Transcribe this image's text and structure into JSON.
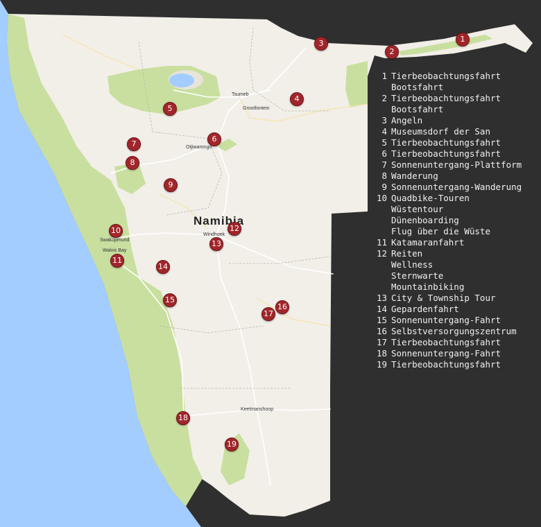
{
  "map": {
    "colors": {
      "background": "#2f2f2f",
      "land": "#f2efe9",
      "ocean": "#a3ccff",
      "park": "#c9df9f",
      "marker": "#a1262b"
    },
    "country_label": "Namibia",
    "places": [
      {
        "id": "tsumeb",
        "label": "Tsumeb"
      },
      {
        "id": "grootfontein",
        "label": "Grootfontein"
      },
      {
        "id": "otjiwarongo",
        "label": "Otjiwarongo"
      },
      {
        "id": "swakopmund",
        "label": "Swakopmund"
      },
      {
        "id": "walvis-bay",
        "label": "Walvis Bay"
      },
      {
        "id": "windhoek",
        "label": "Windhoek"
      },
      {
        "id": "keetmanshoop",
        "label": "Keetmanshoop"
      }
    ],
    "markers": [
      "1",
      "2",
      "3",
      "4",
      "5",
      "6",
      "7",
      "8",
      "9",
      "10",
      "11",
      "12",
      "13",
      "14",
      "15",
      "16",
      "17",
      "18",
      "19"
    ]
  },
  "legend": [
    {
      "num": "1",
      "items": [
        "Tierbeobachtungsfahrt",
        "Bootsfahrt"
      ]
    },
    {
      "num": "2",
      "items": [
        "Tierbeobachtungsfahrt",
        "Bootsfahrt"
      ]
    },
    {
      "num": "3",
      "items": [
        "Angeln"
      ]
    },
    {
      "num": "4",
      "items": [
        "Museumsdorf der San"
      ]
    },
    {
      "num": "5",
      "items": [
        "Tierbeobachtungsfahrt"
      ]
    },
    {
      "num": "6",
      "items": [
        "Tierbeobachtungsfahrt"
      ]
    },
    {
      "num": "7",
      "items": [
        "Sonnenuntergang-Plattform"
      ]
    },
    {
      "num": "8",
      "items": [
        "Wanderung"
      ]
    },
    {
      "num": "9",
      "items": [
        "Sonnenuntergang-Wanderung"
      ]
    },
    {
      "num": "10",
      "items": [
        "Quadbike-Touren",
        "Wüstentour",
        "Dünenboarding",
        "Flug über die Wüste"
      ]
    },
    {
      "num": "11",
      "items": [
        "Katamaranfahrt"
      ]
    },
    {
      "num": "12",
      "items": [
        "Reiten",
        "Wellness",
        "Sternwarte",
        "Mountainbiking"
      ]
    },
    {
      "num": "13",
      "items": [
        "City & Township Tour"
      ]
    },
    {
      "num": "14",
      "items": [
        "Gepardenfahrt"
      ]
    },
    {
      "num": "15",
      "items": [
        "Sonnenuntergang-Fahrt"
      ]
    },
    {
      "num": "16",
      "items": [
        "Selbstversorgungszentrum"
      ]
    },
    {
      "num": "17",
      "items": [
        "Tierbeobachtungsfahrt"
      ]
    },
    {
      "num": "18",
      "items": [
        "Sonnenuntergang-Fahrt"
      ]
    },
    {
      "num": "19",
      "items": [
        "Tierbeobachtungsfahrt"
      ]
    }
  ]
}
